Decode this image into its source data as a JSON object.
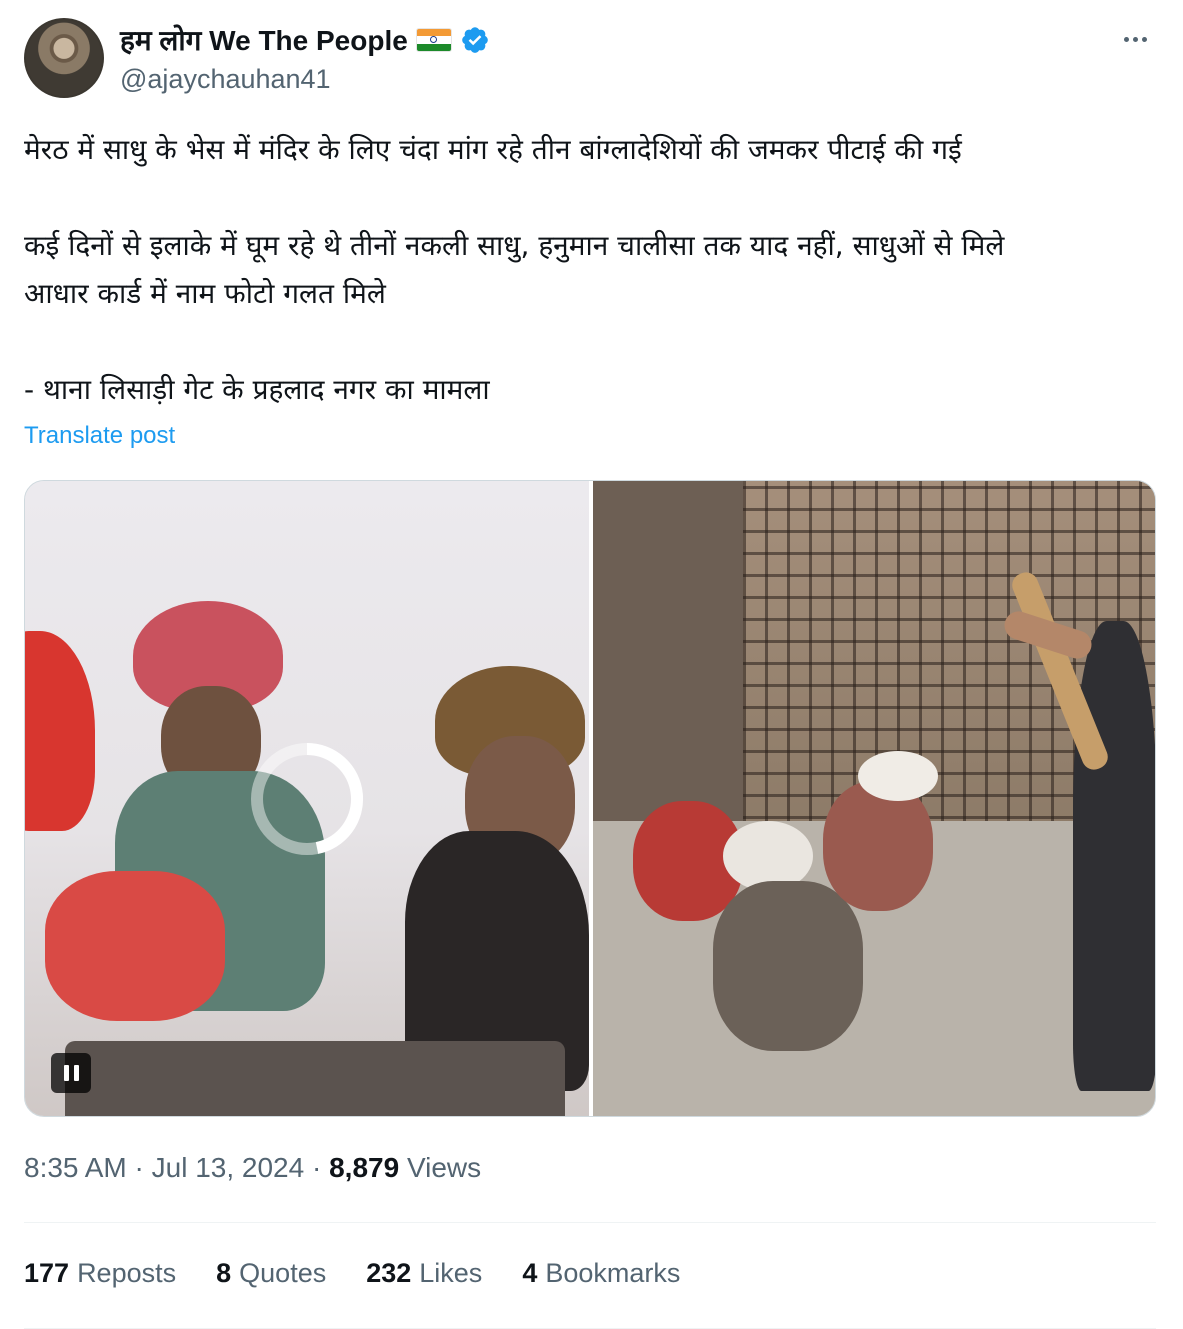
{
  "author": {
    "display_name": "हम लोग We The People",
    "flag": "india-flag-emoji",
    "verified": true,
    "handle": "@ajaychauhan41"
  },
  "post": {
    "line1": "मेरठ में साधु के भेस में मंदिर के लिए चंदा मांग रहे तीन बांग्लादेशियों की जमकर पीटाई की गई",
    "line2a": "कई दिनों से इलाके में घूम रहे थे तीनों नकली साधु, हनुमान चालीसा तक याद नहीं, साधुओं से मिले",
    "line2b": "आधार कार्ड में नाम फोटो गलत मिले",
    "line3": "- थाना लिसाड़ी गेट के प्रहलाद नगर का मामला",
    "translate_label": "Translate post"
  },
  "media": {
    "left": "video-frame-men-in-turbans",
    "right": "photo-men-seated-by-gate-with-stick",
    "pause_icon": "pause-icon",
    "spinner_icon": "loading-spinner-icon"
  },
  "meta": {
    "time": "8:35 AM",
    "sep1": "·",
    "date": "Jul 13, 2024",
    "sep2": "·",
    "views_count": "8,879",
    "views_label": "Views"
  },
  "stats": {
    "reposts_count": "177",
    "reposts_label": "Reposts",
    "quotes_count": "8",
    "quotes_label": "Quotes",
    "likes_count": "232",
    "likes_label": "Likes",
    "bookmarks_count": "4",
    "bookmarks_label": "Bookmarks"
  },
  "colors": {
    "link": "#1d9bf0",
    "muted": "#536471",
    "text": "#0f1419"
  }
}
